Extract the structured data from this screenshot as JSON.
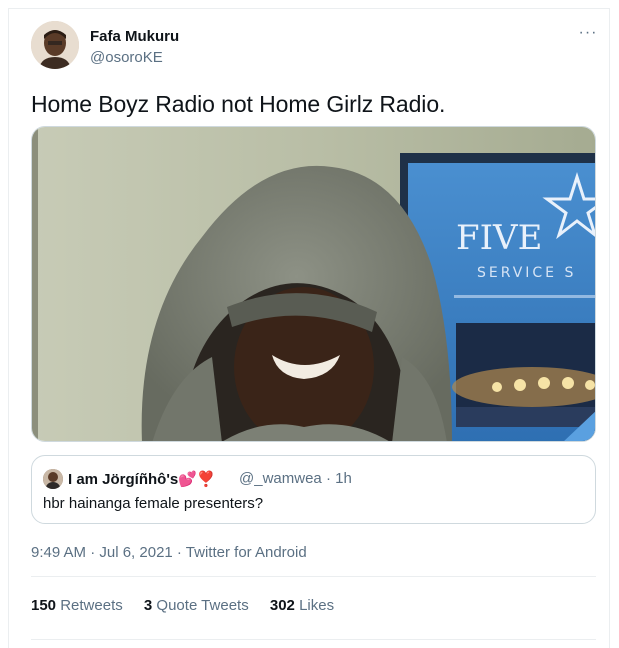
{
  "tweet": {
    "author_name": "Fafa Mukuru",
    "author_handle": "@osoroKE",
    "more_label": "···",
    "text": "Home Boyz Radio not Home Girlz Radio.",
    "timestamp": "9:49 AM · Jul 6, 2021 · Twitter for Android"
  },
  "media": {
    "sign_line1": "FIVE",
    "sign_line2": "SERVICE S"
  },
  "quoted": {
    "author_name": "I am Jörgíñhô's💕❣️",
    "author_handle": "@_wamwea",
    "time": "· 1h",
    "text": "hbr hainanga female presenters?"
  },
  "stats": {
    "retweets_count": "150",
    "retweets_label": "Retweets",
    "quotes_count": "3",
    "quotes_label": "Quote Tweets",
    "likes_count": "302",
    "likes_label": "Likes"
  }
}
